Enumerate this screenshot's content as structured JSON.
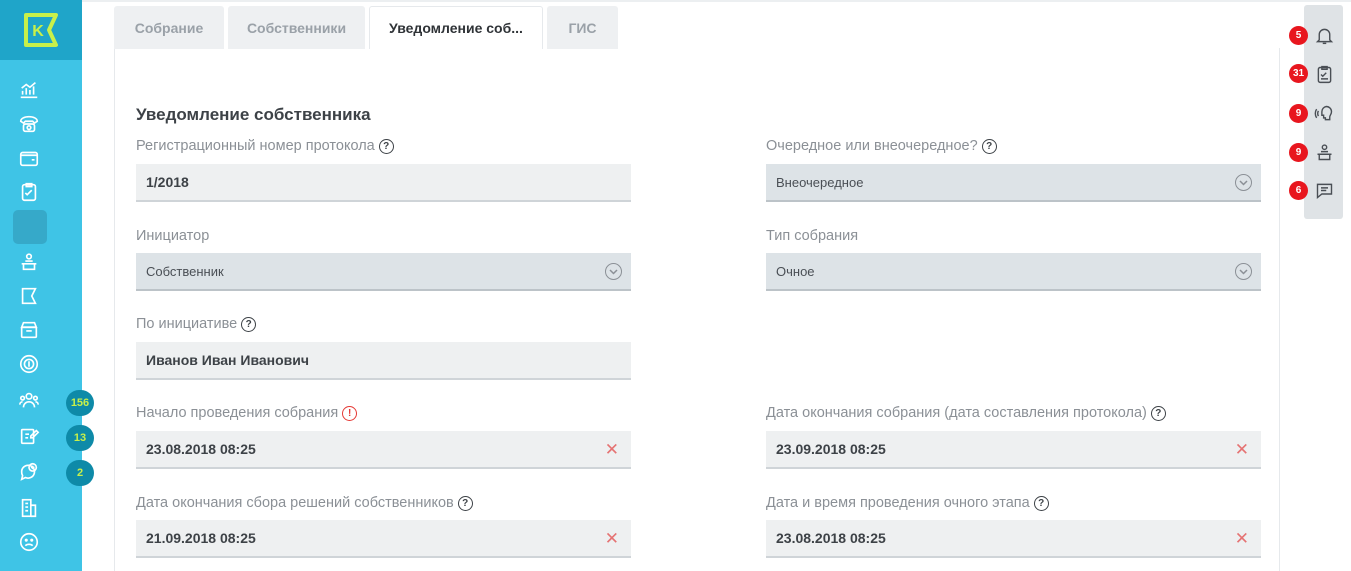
{
  "tabs": [
    {
      "label": "Собрание"
    },
    {
      "label": "Собственники"
    },
    {
      "label": "Уведомление соб..."
    },
    {
      "label": "ГИС"
    }
  ],
  "section": {
    "title": "Уведомление собственника"
  },
  "fields": {
    "reg_number": {
      "label": "Регистрационный номер протокола",
      "value": "1/2018"
    },
    "regular": {
      "label": "Очередное или внеочередное?",
      "value": "Внеочередное"
    },
    "initiator": {
      "label": "Инициатор",
      "value": "Собственник"
    },
    "meeting_type": {
      "label": "Тип собрания",
      "value": "Очное"
    },
    "by_initiative": {
      "label": "По инициативе",
      "value": "Иванов Иван Иванович"
    },
    "start": {
      "label": "Начало проведения собрания",
      "value": "23.08.2018 08:25"
    },
    "end": {
      "label": "Дата окончания собрания (дата составления протокола)",
      "value": "23.09.2018 08:25"
    },
    "collect_end": {
      "label": "Дата окончания сбора решений собственников",
      "value": "21.09.2018 08:25"
    },
    "in_person": {
      "label": "Дата и время проведения очного этапа",
      "value": "23.08.2018 08:25"
    }
  },
  "sidebar": {
    "logo_letter": "K",
    "badges": [
      "156",
      "13",
      "2"
    ]
  },
  "right_panel": {
    "badges": [
      "5",
      "31",
      "9",
      "9",
      "6"
    ]
  },
  "colors": {
    "sidebar": "#3fc4e6",
    "logo_bg": "#1fa5c9",
    "badge_red": "#e8161e",
    "sidebar_badge": "#0e8aa8"
  }
}
